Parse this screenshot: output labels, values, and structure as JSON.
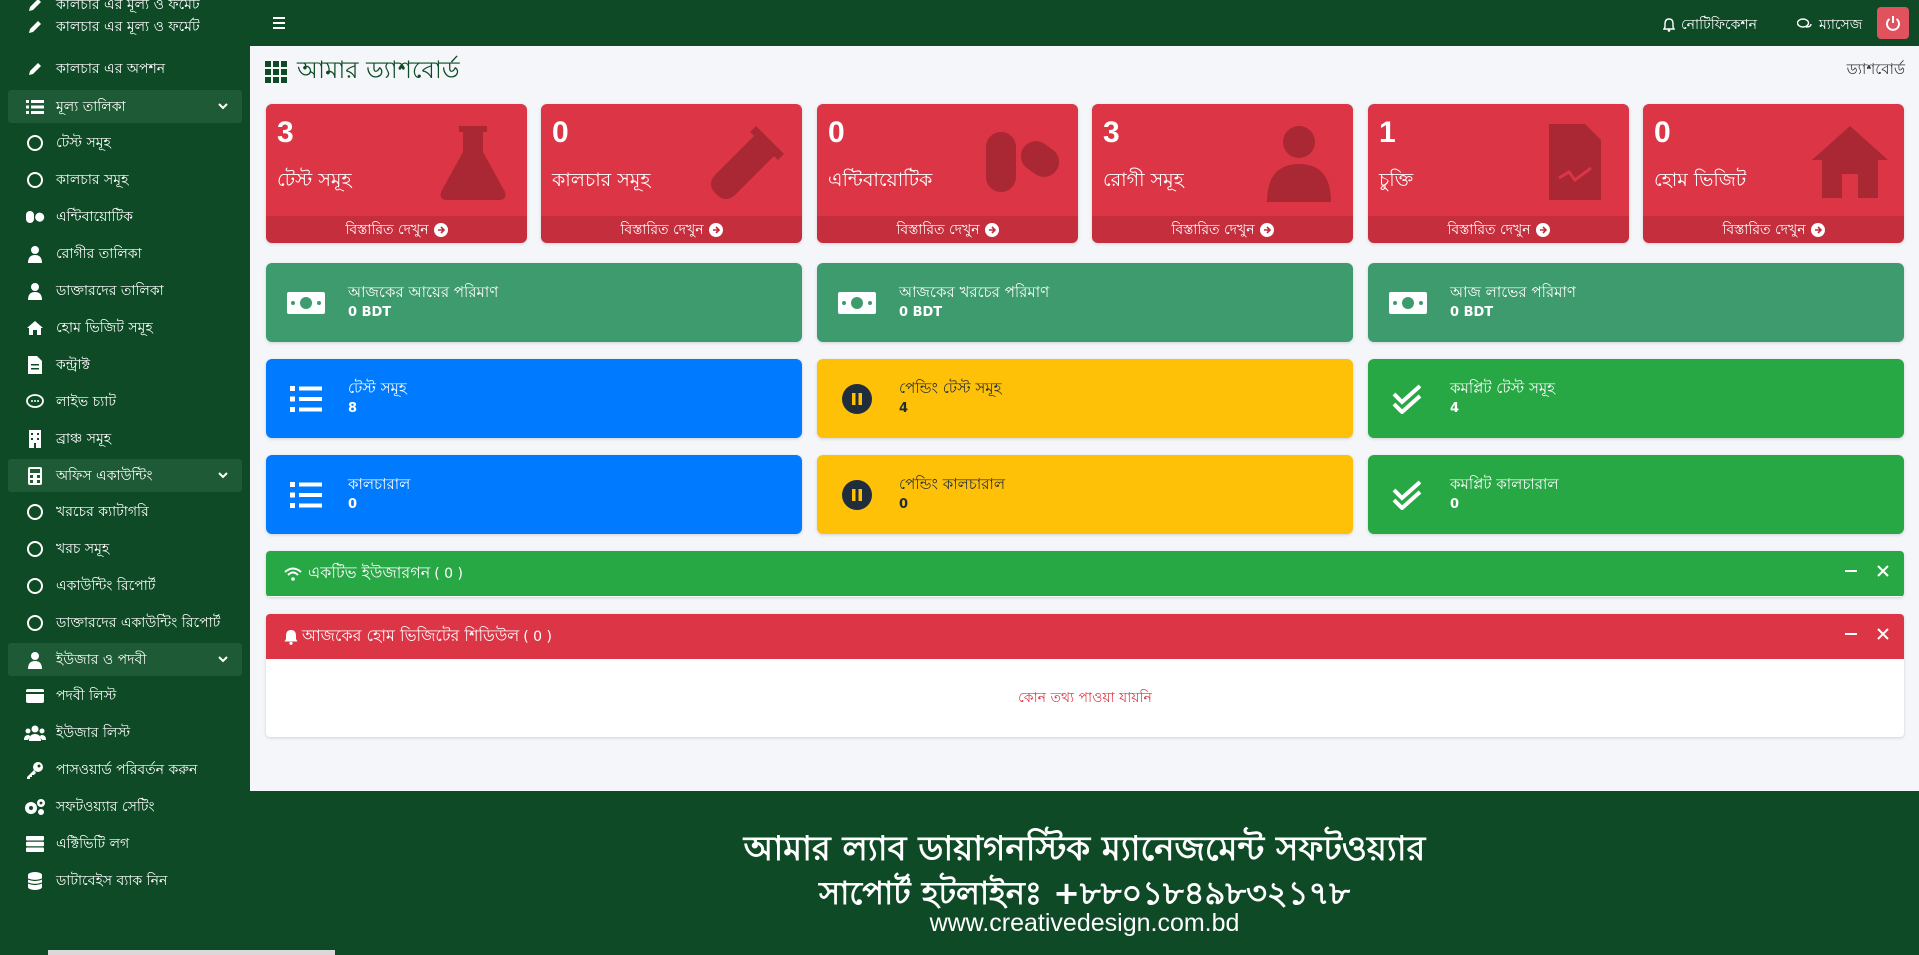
{
  "sidebar": {
    "items": [
      {
        "label": "কালচার এর মূল্য ও ফর্মেট",
        "icon": "pen-icon",
        "type": "item"
      },
      {
        "label": "কালচার এর অপশন",
        "icon": "pen-icon",
        "type": "item"
      },
      {
        "label": "মূল্য তালিকা",
        "icon": "list-icon",
        "type": "section"
      },
      {
        "label": "টেস্ট সমূহ",
        "icon": "circle-icon",
        "type": "item"
      },
      {
        "label": "কালচার সমূহ",
        "icon": "circle-icon",
        "type": "item"
      },
      {
        "label": "এন্টিবায়োটিক",
        "icon": "capsules-icon",
        "type": "item"
      },
      {
        "label": "রোগীর তালিকা",
        "icon": "user-injured-icon",
        "type": "item"
      },
      {
        "label": "ডাক্তারদের তালিকা",
        "icon": "user-md-icon",
        "type": "item"
      },
      {
        "label": "হোম ভিজিট সমূহ",
        "icon": "home-icon",
        "type": "item"
      },
      {
        "label": "কন্ট্রাক্ট",
        "icon": "file-contract-icon",
        "type": "item"
      },
      {
        "label": "লাইভ চ্যাট",
        "icon": "comment-icon",
        "type": "item"
      },
      {
        "label": "ব্রাঞ্চ সমূহ",
        "icon": "building-icon",
        "type": "item"
      },
      {
        "label": "অফিস একাউন্টিং",
        "icon": "calculator-icon",
        "type": "section"
      },
      {
        "label": "খরচের ক্যাটাগরি",
        "icon": "circle-icon",
        "type": "item"
      },
      {
        "label": "খরচ সমূহ",
        "icon": "circle-icon",
        "type": "item"
      },
      {
        "label": "একাউন্টিং রিপোর্ট",
        "icon": "circle-icon",
        "type": "item"
      },
      {
        "label": "ডাক্তারদের একাউন্টিং রিপোর্ট",
        "icon": "circle-icon",
        "type": "item"
      },
      {
        "label": "ইউজার ও পদবী",
        "icon": "user-icon",
        "type": "section"
      },
      {
        "label": "পদবী লিস্ট",
        "icon": "id-card-icon",
        "type": "item"
      },
      {
        "label": "ইউজার লিস্ট",
        "icon": "users-icon",
        "type": "item"
      },
      {
        "label": "পাসওয়ার্ড পরিবর্তন করুন",
        "icon": "key-icon",
        "type": "item"
      },
      {
        "label": "সফটওয়্যার সেটিং",
        "icon": "cogs-icon",
        "type": "item"
      },
      {
        "label": "এক্টিভিটি লগ",
        "icon": "server-icon",
        "type": "item"
      },
      {
        "label": "ডাটাবেইস ব্যাক নিন",
        "icon": "database-icon",
        "type": "item"
      }
    ]
  },
  "topbar": {
    "notification_label": "নোটিফিকেশন",
    "message_label": "ম্যাসেজ"
  },
  "page": {
    "title": "আমার ড্যাশবোর্ড",
    "breadcrumb": "ড্যাশবোর্ড"
  },
  "small_boxes": [
    {
      "count": "3",
      "label": "টেস্ট সমূহ",
      "footer": "বিস্তারিত দেখুন",
      "icon": "flask-icon"
    },
    {
      "count": "0",
      "label": "কালচার সমূহ",
      "footer": "বিস্তারিত দেখুন",
      "icon": "vial-icon"
    },
    {
      "count": "0",
      "label": "এন্টিবায়োটিক",
      "footer": "বিস্তারিত দেখুন",
      "icon": "capsules-icon"
    },
    {
      "count": "3",
      "label": "রোগী সমূহ",
      "footer": "বিস্তারিত দেখুন",
      "icon": "user-injured-icon"
    },
    {
      "count": "1",
      "label": "চুক্তি",
      "footer": "বিস্তারিত দেখুন",
      "icon": "file-contract-icon"
    },
    {
      "count": "0",
      "label": "হোম ভিজিট",
      "footer": "বিস্তারিত দেখুন",
      "icon": "home-icon"
    }
  ],
  "money_boxes": [
    {
      "label": "আজকের আয়ের পরিমাণ",
      "value": "0 BDT"
    },
    {
      "label": "আজকের খরচের পরিমাণ",
      "value": "0 BDT"
    },
    {
      "label": "আজ লাভের পরিমাণ",
      "value": "0 BDT"
    }
  ],
  "test_boxes": [
    {
      "label": "টেস্ট সমূহ",
      "value": "8"
    },
    {
      "label": "পেন্ডিং টেস্ট সমূহ",
      "value": "4"
    },
    {
      "label": "কমপ্লিট টেস্ট সমূহ",
      "value": "4"
    }
  ],
  "culture_boxes": [
    {
      "label": "কালচারাল",
      "value": "0"
    },
    {
      "label": "পেন্ডিং কালচারাল",
      "value": "0"
    },
    {
      "label": "কমপ্লিট কালচারাল",
      "value": "0"
    }
  ],
  "active_users_card": {
    "title": "একটিভ ইউজারগন",
    "count": "( 0 )"
  },
  "home_visit_card": {
    "title": "আজকের হোম ভিজিটের শিডিউল",
    "count": "( 0 )",
    "empty_message": "কোন তথ্য পাওয়া যায়নি"
  },
  "footer": {
    "line1": "আমার ল্যাব ডায়াগনস্টিক ম্যানেজমেন্ট সফটওয়্যার",
    "line2": "সাপোর্ট হটলাইনঃ +৮৮০১৮৪৯৮৩২১৭৮",
    "line3": "www.creativedesign.com.bd"
  },
  "colors": {
    "brand": "#0f4a26",
    "danger": "#dc3545",
    "success": "#28a745",
    "primary": "#007bff",
    "warning": "#ffc107"
  }
}
